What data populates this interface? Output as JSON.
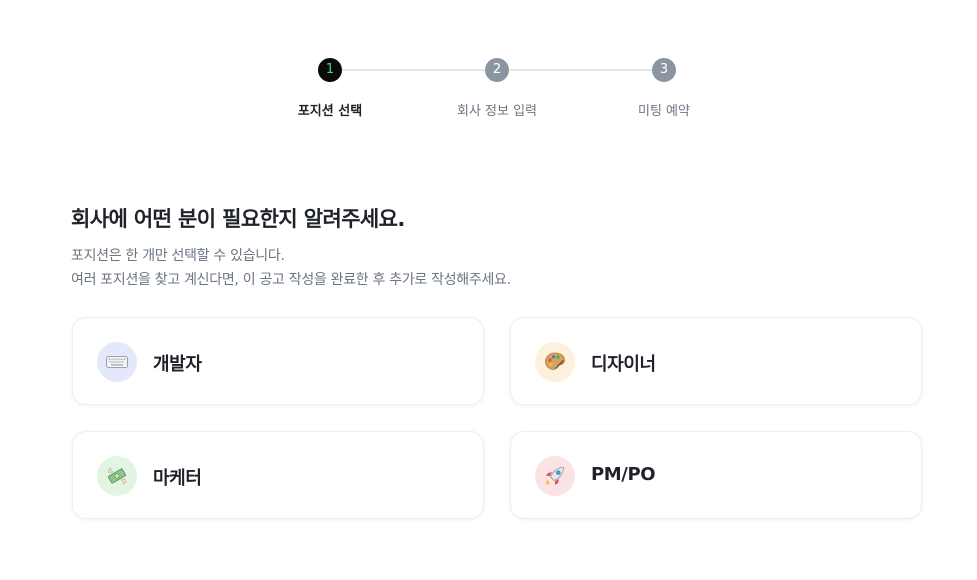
{
  "stepper": {
    "steps": [
      {
        "number": "1",
        "label": "포지션 선택",
        "active": true
      },
      {
        "number": "2",
        "label": "회사 정보 입력",
        "active": false
      },
      {
        "number": "3",
        "label": "미팅 예약",
        "active": false
      }
    ]
  },
  "main": {
    "title": "회사에 어떤 분이 필요한지 알려주세요.",
    "description_line1": "포지션은 한 개만 선택할 수 있습니다.",
    "description_line2": "여러 포지션을 찾고 계신다면, 이 공고 작성을 완료한 후 추가로 작성해주세요."
  },
  "positions": [
    {
      "label": "개발자",
      "icon": "keyboard-icon",
      "icon_bg": "#e3e9fb"
    },
    {
      "label": "디자이너",
      "icon": "palette-icon",
      "icon_bg": "#fdf1dd"
    },
    {
      "label": "마케터",
      "icon": "money-with-wings-icon",
      "icon_bg": "#e2f5e3"
    },
    {
      "label": "PM/PO",
      "icon": "rocket-icon",
      "icon_bg": "#fbe3e4"
    }
  ],
  "colors": {
    "active_step_bg": "#0a0a0a",
    "active_step_number": "#34e37a",
    "inactive_step_bg": "#8b95a1"
  }
}
